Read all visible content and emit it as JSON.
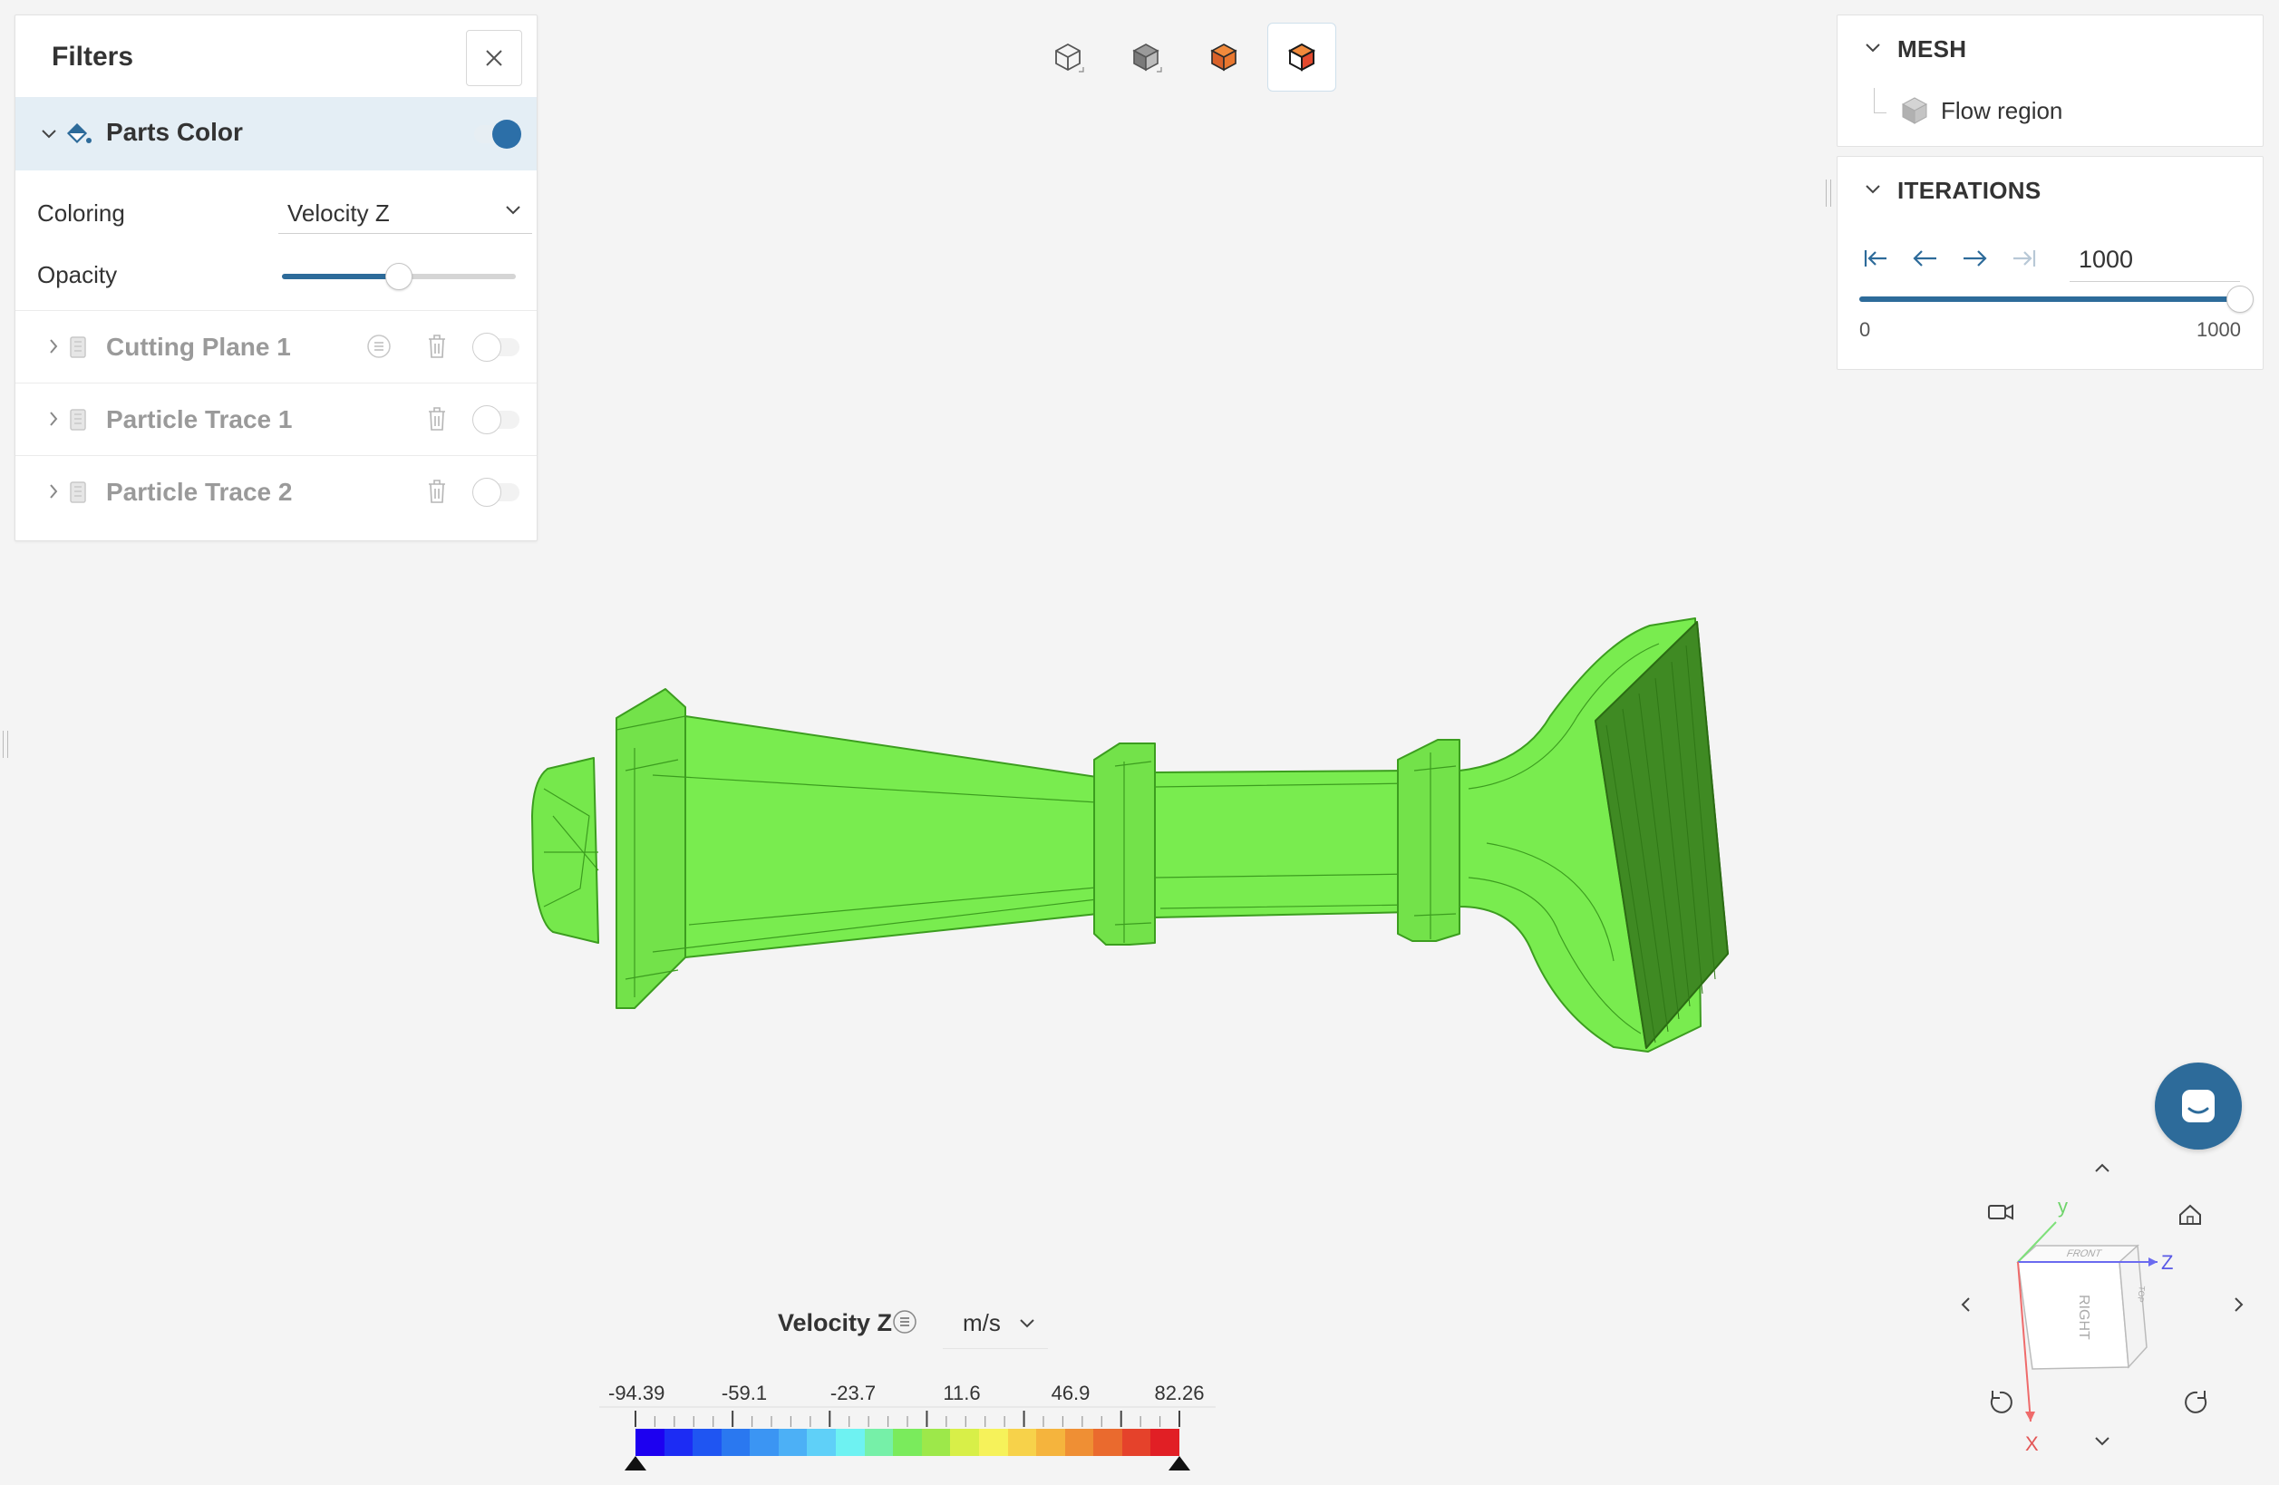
{
  "filters": {
    "title": "Filters",
    "parts_color": {
      "label": "Parts Color",
      "enabled": true
    },
    "coloring": {
      "label": "Coloring",
      "value": "Velocity Z"
    },
    "opacity": {
      "label": "Opacity",
      "value": 0.5
    },
    "items": [
      {
        "label": "Cutting Plane 1",
        "enabled": false,
        "has_menu": true
      },
      {
        "label": "Particle Trace 1",
        "enabled": false,
        "has_menu": false
      },
      {
        "label": "Particle Trace 2",
        "enabled": false,
        "has_menu": false
      }
    ]
  },
  "view_modes": [
    "wireframe-view-icon",
    "solid-view-icon",
    "surface-view-icon",
    "surface-edges-view-icon"
  ],
  "mesh": {
    "title": "MESH",
    "item": "Flow region"
  },
  "iterations": {
    "title": "ITERATIONS",
    "value": "1000",
    "min": "0",
    "max": "1000",
    "fraction": 1.0
  },
  "legend": {
    "title": "Velocity Z",
    "unit": "m/s",
    "ticks": [
      "-94.39",
      "-59.1",
      "-23.7",
      "11.6",
      "46.9",
      "82.26"
    ],
    "colors": [
      "#1d00f0",
      "#1c2cf4",
      "#1f55f2",
      "#2a78f0",
      "#3b95f3",
      "#4cb0f6",
      "#5fd0f8",
      "#6ef2f2",
      "#76f0a8",
      "#7aeb5c",
      "#9de84a",
      "#d8ef48",
      "#f6f25a",
      "#f7d24a",
      "#f5b43d",
      "#ef8f34",
      "#ea6a2e",
      "#e5422b",
      "#e11f25"
    ]
  },
  "nav_cube": {
    "axis_x": "X",
    "axis_y": "y",
    "axis_z": "Z",
    "face_right": "RIGHT",
    "face_front": "FRONT",
    "face_top": "TOP"
  },
  "colors": {
    "accent": "#2d6b9a",
    "model_fill": "#79ec4f",
    "model_edge": "#3c9d1f"
  }
}
